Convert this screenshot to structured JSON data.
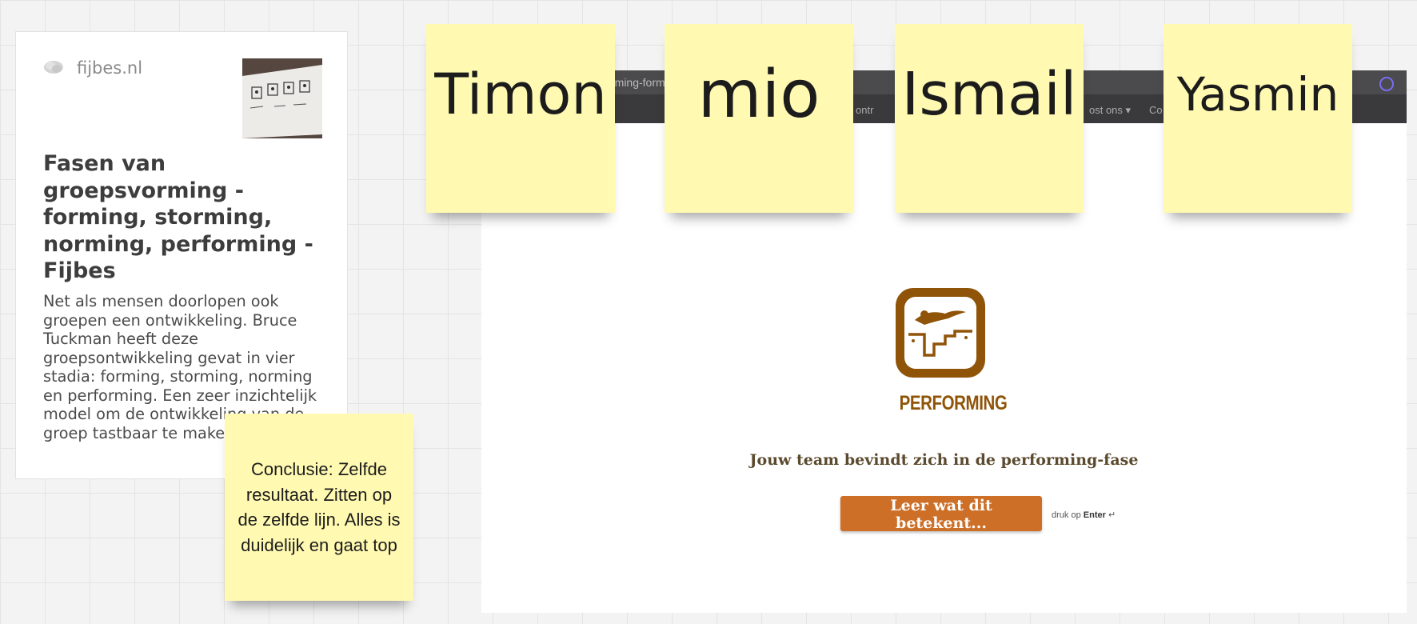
{
  "link_card": {
    "site": "fijbes.nl",
    "title": "Fasen van groepsvorming - forming, storming, norming, performing - Fijbes",
    "description": "Net als mensen doorlopen ook groepen een ontwikkeling. Bruce Tuckman heeft deze groepsontwikkeling gevat in vier stadia: forming, storming, norming en performing. Een zeer inzichtelijk model om de ontwikkeling van de groep tastbaar te maken ..."
  },
  "screenshot": {
    "url_fragment": "rming-form",
    "nav_fragment_1": "ontr",
    "nav_fragment_2": "ost ons ▾",
    "nav_fragment_3": "Co",
    "logo_label": "PERFORMING",
    "tagline": "Jouw team bevindt zich in de performing-fase",
    "cta_label": "Leer wat dit betekent...",
    "hint_prefix": "druk op",
    "hint_key": "Enter",
    "hint_symbol": "↵",
    "brand_color": "#cd6f27",
    "logo_color": "#8f5408"
  },
  "stickies": {
    "names": [
      "Timon",
      "mio",
      "Ismail",
      "Yasmin"
    ],
    "conclusion": "Conclusie: Zelfde resultaat. Zitten op de zelfde lijn. Alles is duidelijk en gaat top",
    "color": "#fff9b1"
  }
}
